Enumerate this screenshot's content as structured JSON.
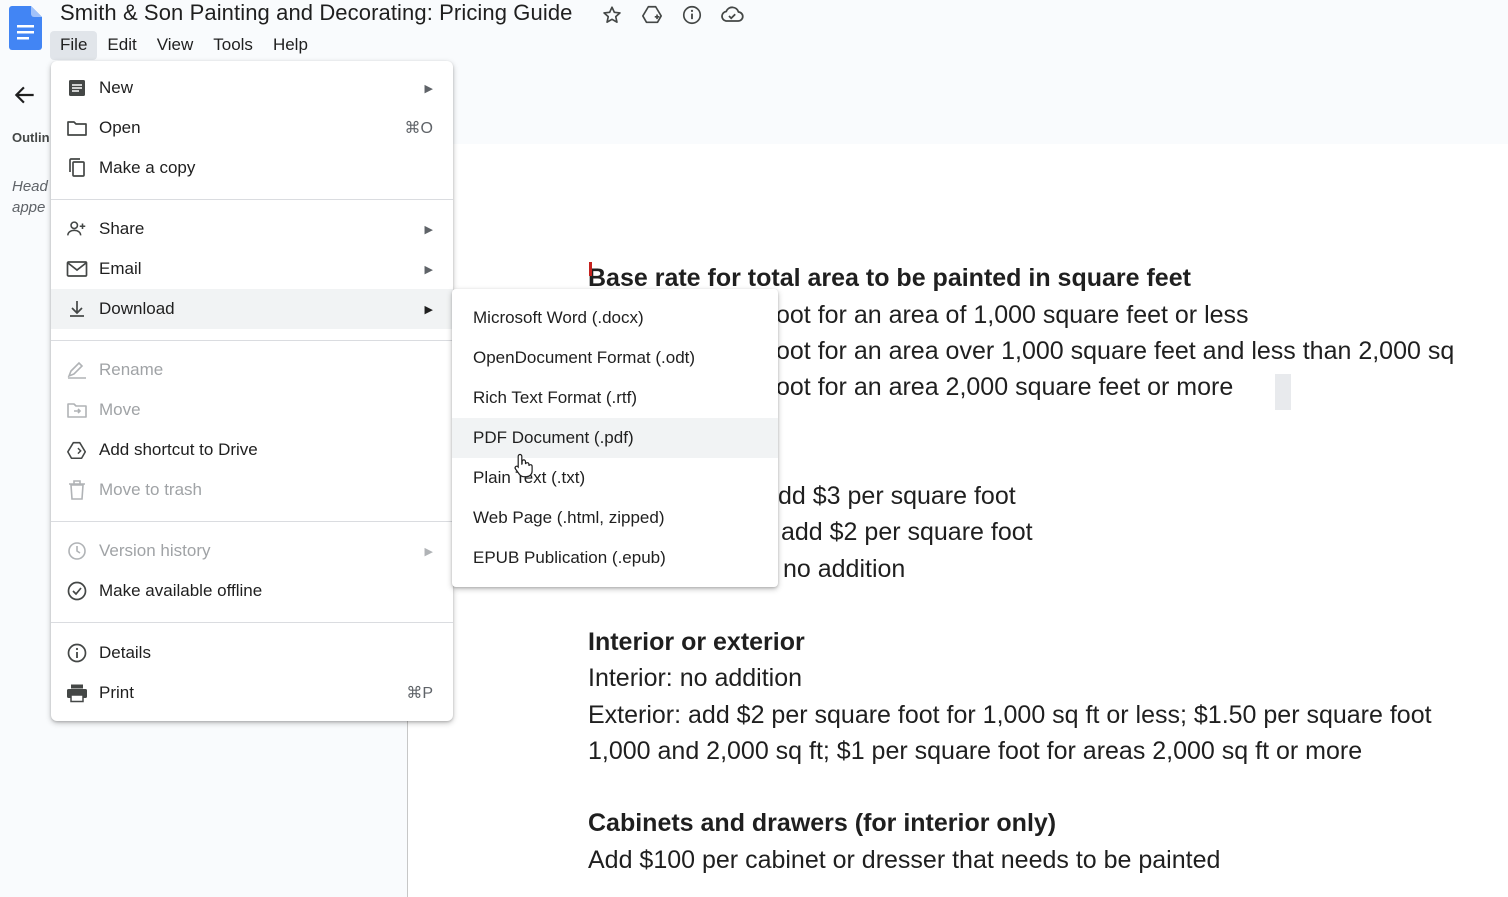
{
  "window": {
    "title": "Smith & Son Painting and Decorating: Pricing Guide"
  },
  "title_icons": [
    "star-icon",
    "move-to-drive-icon",
    "info-icon",
    "cloud-saved-icon"
  ],
  "menubar": {
    "items": [
      {
        "label": "File",
        "active": true
      },
      {
        "label": "Edit"
      },
      {
        "label": "View"
      },
      {
        "label": "Tools"
      },
      {
        "label": "Help"
      }
    ]
  },
  "outline": {
    "label": "Outlin",
    "hint_line1": "Head",
    "hint_line2": "appe"
  },
  "file_menu": {
    "items": [
      {
        "label": "New",
        "icon": "document-icon",
        "submenu": true
      },
      {
        "label": "Open",
        "icon": "folder-icon",
        "shortcut": "⌘O"
      },
      {
        "label": "Make a copy",
        "icon": "copy-icon"
      },
      {
        "label": "Share",
        "icon": "share-person-icon",
        "submenu": true
      },
      {
        "label": "Email",
        "icon": "envelope-icon",
        "submenu": true
      },
      {
        "label": "Download",
        "icon": "download-icon",
        "submenu": true,
        "highlighted": true
      },
      {
        "label": "Rename",
        "icon": "rename-pencil-icon",
        "disabled": true
      },
      {
        "label": "Move",
        "icon": "move-folder-icon",
        "disabled": true
      },
      {
        "label": "Add shortcut to Drive",
        "icon": "drive-shortcut-icon"
      },
      {
        "label": "Move to trash",
        "icon": "trash-icon",
        "disabled": true
      },
      {
        "label": "Version history",
        "icon": "history-icon",
        "submenu": true,
        "disabled": true
      },
      {
        "label": "Make available offline",
        "icon": "offline-check-icon"
      },
      {
        "label": "Details",
        "icon": "info-icon"
      },
      {
        "label": "Print",
        "icon": "printer-icon",
        "shortcut": "⌘P"
      }
    ]
  },
  "download_submenu": {
    "items": [
      {
        "label": "Microsoft Word (.docx)"
      },
      {
        "label": "OpenDocument Format (.odt)"
      },
      {
        "label": "Rich Text Format (.rtf)"
      },
      {
        "label": "PDF Document (.pdf)",
        "highlighted": true
      },
      {
        "label": "Plain Text (.txt)"
      },
      {
        "label": "Web Page (.html, zipped)"
      },
      {
        "label": "EPUB Publication (.epub)"
      }
    ]
  },
  "document": {
    "heading1": "Base rate for total area to be painted in square feet",
    "line1": "oot for an area of 1,000 square feet or less",
    "line2": "oot for an area over 1,000 square feet and less than 2,000 sq",
    "line3": "oot for an area 2,000 square feet or more",
    "line4": "dd $3 per square foot",
    "line5": "add $2 per square foot",
    "line6": "no addition",
    "heading2": "Interior or exterior",
    "line7": "Interior: no addition",
    "line8": "Exterior: add $2 per square foot for 1,000 sq ft or less; $1.50 per square foot",
    "line9": "1,000 and 2,000 sq ft; $1 per square foot for areas 2,000 sq ft or more",
    "heading3": "Cabinets and drawers (for interior only)",
    "line10": "Add $100 per cabinet or dresser that needs to be painted"
  },
  "colors": {
    "accent_blue": "#4285f4",
    "highlight": "#f1f3f4",
    "disabled_text": "#a0a3a6"
  }
}
